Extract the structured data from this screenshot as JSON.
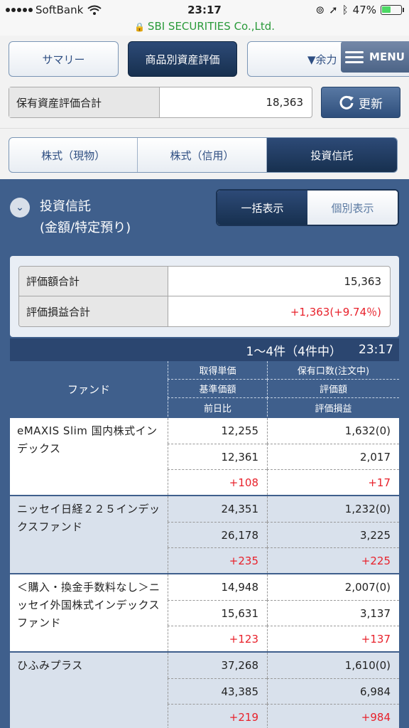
{
  "status_bar": {
    "carrier": "SoftBank",
    "time": "23:17",
    "battery": "47%",
    "battery_level": 0.47
  },
  "url_bar": {
    "domain": "SBI SECURITIES Co.,Ltd."
  },
  "top_tabs": {
    "summary": "サマリー",
    "by_product": "商品別資産評価",
    "margin": "▼余力",
    "menu": "MENU"
  },
  "holdings_total": {
    "label": "保有資産評価合計",
    "value": "18,363",
    "refresh": "更新"
  },
  "segments": [
    "株式（現物）",
    "株式（信用）",
    "投資信託"
  ],
  "section": {
    "title_line1": "投資信託",
    "title_line2": "(金額/特定預り)",
    "toggle_all": "一括表示",
    "toggle_each": "個別表示"
  },
  "summary": {
    "eval_label": "評価額合計",
    "eval_value": "15,363",
    "pl_label": "評価損益合計",
    "pl_value": "+1,363(+9.74％)"
  },
  "count_bar": {
    "range": "1〜4件（4件中）",
    "time": "23:17"
  },
  "table_header": {
    "fund": "ファンド",
    "acq_price": "取得単価",
    "units": "保有口数(注文中)",
    "base_price": "基準価額",
    "eval": "評価額",
    "day_change": "前日比",
    "pl": "評価損益"
  },
  "funds": [
    {
      "name": "eMAXIS Slim 国内株式インデックス",
      "acq_price": "12,255",
      "units": "1,632(0)",
      "base_price": "12,361",
      "eval": "2,017",
      "day_change": "+108",
      "pl": "+17"
    },
    {
      "name": "ニッセイ日経２２５インデックスファンド",
      "acq_price": "24,351",
      "units": "1,232(0)",
      "base_price": "26,178",
      "eval": "3,225",
      "day_change": "+235",
      "pl": "+225"
    },
    {
      "name": "＜購入・換金手数料なし＞ニッセイ外国株式インデックスファンド",
      "acq_price": "14,948",
      "units": "2,007(0)",
      "base_price": "15,631",
      "eval": "3,137",
      "day_change": "+123",
      "pl": "+137"
    },
    {
      "name": "ひふみプラス",
      "acq_price": "37,268",
      "units": "1,610(0)",
      "base_price": "43,385",
      "eval": "6,984",
      "day_change": "+219",
      "pl": "+984"
    }
  ],
  "colors": {
    "navy": "#17304f",
    "panel_blue": "#3f5f8c",
    "positive_red": "#e8212b",
    "secure_green": "#2a9a3a"
  }
}
